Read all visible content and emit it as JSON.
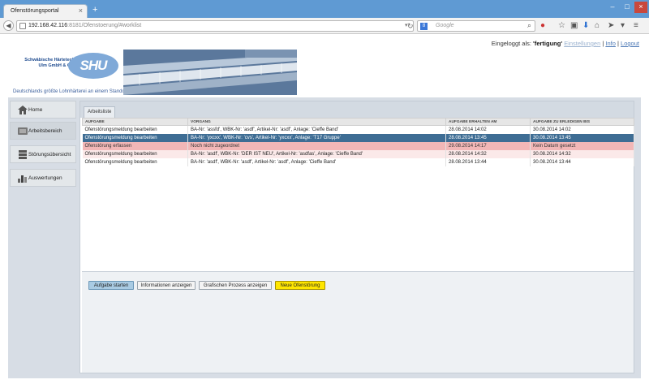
{
  "browser": {
    "tab_title": "Ofenstörungsportal",
    "url_host": "192.168.42.116",
    "url_rest": ":8181/Ofenstoerung/#worklist",
    "search_placeholder": "Google",
    "search_engine_letter": "8"
  },
  "header": {
    "logged_label": "Eingeloggt als:",
    "user": "'fertigung'",
    "link_settings": "Einstellungen",
    "sep1": "|",
    "link_info": "Info",
    "sep2": "|",
    "link_logout": "Logout",
    "logo_line1": "Schwäbische Härtetechnik",
    "logo_line2": "Ulm GmbH & Co KG",
    "logo_brand": "SHU",
    "tagline": "Deutschlands größte Lohnhärterei an einem Standort"
  },
  "sidebar": {
    "items": [
      {
        "label": "Home"
      },
      {
        "label": "Arbeitsbereich"
      },
      {
        "label": "Störungsübersicht"
      },
      {
        "label": "Auswertungen"
      }
    ]
  },
  "worklist": {
    "tab": "Arbeitsliste",
    "columns": [
      "Aufgabe",
      "Vorgang",
      "Aufgabe erhalten am",
      "Aufgabe zu erledigen bis"
    ],
    "rows": [
      [
        "Ofenstörungsmeldung bearbeiten",
        "BA-Nr: 'assfd', WBK-Nr: 'asdf', Artikel-Nr: 'asdf', Anlage: 'Cieffe Band'",
        "28.08.2014 14:02",
        "30.08.2014 14:02"
      ],
      [
        "Ofenstörungsmeldung bearbeiten",
        "BA-Nr: 'yxcxx', WBK-Nr: 'cvs', Artikel-Nr: 'yxcxx', Anlage: 'T17 Gruppe'",
        "28.08.2014 13:45",
        "30.08.2014 13:45"
      ],
      [
        "Ofenstörung erfassen",
        "Noch nicht zugeordnet",
        "29.08.2014 14:17",
        "Kein Datum gesetzt"
      ],
      [
        "Ofenstörungsmeldung bearbeiten",
        "BA-Nr: 'asdf', WBK-Nr: 'DER IST NEU', Artikel-Nr: 'asdfas', Anlage: 'Cieffe Band'",
        "28.08.2014 14:32",
        "30.08.2014 14:32"
      ],
      [
        "Ofenstörungsmeldung bearbeiten",
        "BA-Nr: 'asdf', WBK-Nr: 'asdf', Artikel-Nr: 'asdf', Anlage: 'Cieffe Band'",
        "28.08.2014 13:44",
        "30.08.2014 13:44"
      ]
    ]
  },
  "buttons": {
    "start": "Aufgabe starten",
    "info": "Informationen anzeigen",
    "graph": "Grafischen Prozess anzeigen",
    "new": "Neue Ofenstörung"
  },
  "colors": {
    "selected_row": "#3e6d94",
    "overdue_row": "#f2b7b7",
    "highlight_button": "#ffe600",
    "titlebar": "#5f9ad3"
  }
}
